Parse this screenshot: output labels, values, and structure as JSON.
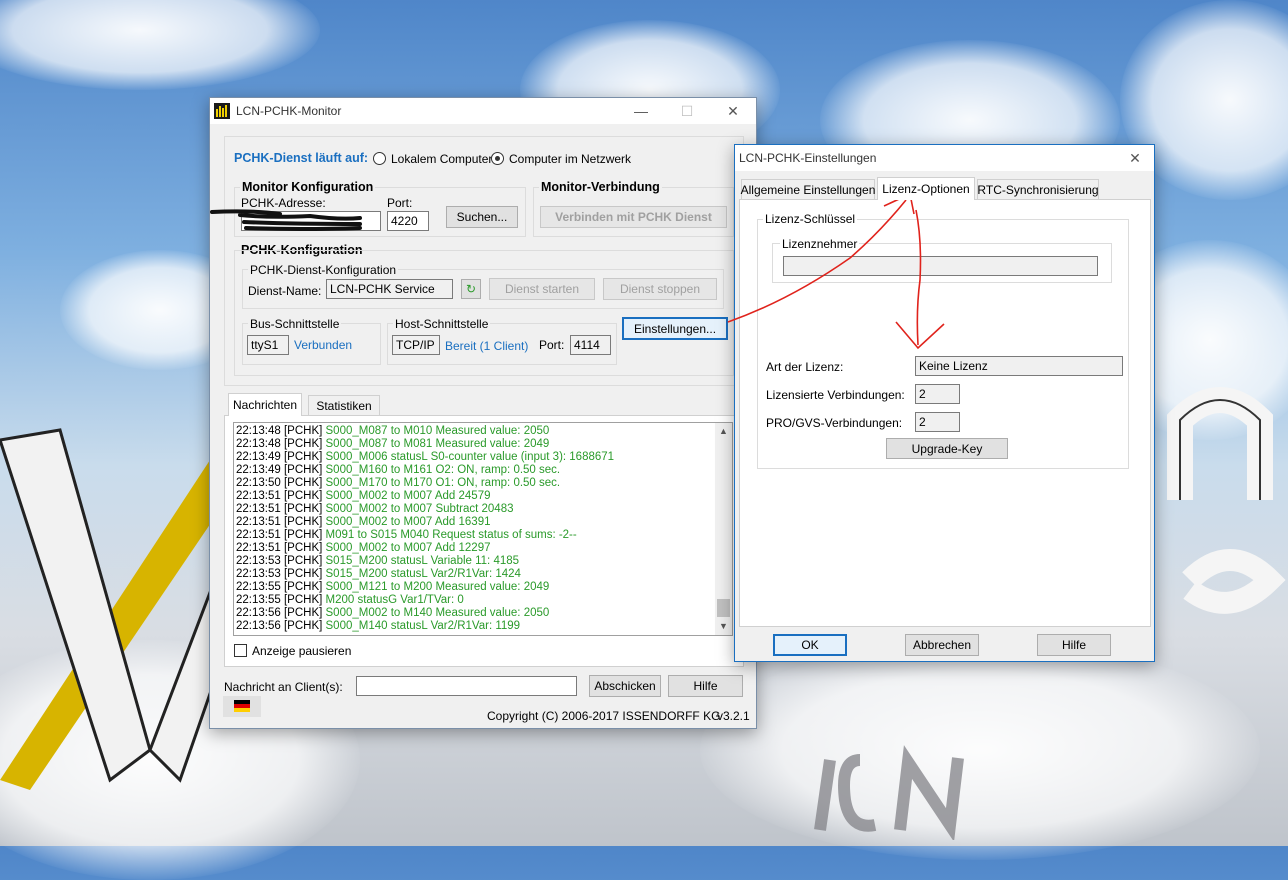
{
  "monitor": {
    "title": "LCN-PCHK-Monitor",
    "service_runs_on_label": "PCHK-Dienst läuft auf:",
    "radio_local": "Lokalem Computer",
    "radio_network": "Computer im Netzwerk",
    "monitor_config_title": "Monitor Konfiguration",
    "pchk_address_label": "PCHK-Adresse:",
    "pchk_address_value": "",
    "port_label": "Port:",
    "port_value": "4220",
    "search_button": "Suchen...",
    "monitor_connection_title": "Monitor-Verbindung",
    "connect_button": "Verbinden mit  PCHK Dienst",
    "pchk_config_title": "PCHK-Konfiguration",
    "service_config_title": "PCHK-Dienst-Konfiguration",
    "service_name_label": "Dienst-Name:",
    "service_name_value": "LCN-PCHK Service",
    "start_service_button": "Dienst starten",
    "stop_service_button": "Dienst stoppen",
    "bus_interface_title": "Bus-Schnittstelle",
    "bus_interface_value": "ttyS1",
    "bus_status": "Verbunden",
    "host_interface_title": "Host-Schnittstelle",
    "host_interface_value": "TCP/IP",
    "host_status": "Bereit (1 Client)",
    "host_port_label": "Port:",
    "host_port_value": "4114",
    "settings_button": "Einstellungen...",
    "tabs": [
      "Nachrichten",
      "Statistiken"
    ],
    "log": [
      {
        "time": "22:13:48",
        "src": "[PCHK]",
        "msg": "S000_M087 to M010 Measured value: 2050"
      },
      {
        "time": "22:13:48",
        "src": "[PCHK]",
        "msg": "S000_M087 to M081 Measured value: 2049"
      },
      {
        "time": "22:13:49",
        "src": "[PCHK]",
        "msg": "S000_M006 statusL S0-counter value (input 3): 1688671"
      },
      {
        "time": "22:13:49",
        "src": "[PCHK]",
        "msg": "S000_M160 to M161 O2: ON, ramp: 0.50 sec."
      },
      {
        "time": "22:13:50",
        "src": "[PCHK]",
        "msg": "S000_M170 to M170 O1: ON, ramp: 0.50 sec."
      },
      {
        "time": "22:13:51",
        "src": "[PCHK]",
        "msg": "S000_M002 to M007 Add 24579"
      },
      {
        "time": "22:13:51",
        "src": "[PCHK]",
        "msg": "S000_M002 to M007 Subtract 20483"
      },
      {
        "time": "22:13:51",
        "src": "[PCHK]",
        "msg": "S000_M002 to M007 Add 16391"
      },
      {
        "time": "22:13:51",
        "src": "[PCHK]",
        "msg": "M091 to S015 M040 Request status of sums: -2--"
      },
      {
        "time": "22:13:51",
        "src": "[PCHK]",
        "msg": "S000_M002 to M007 Add 12297"
      },
      {
        "time": "22:13:53",
        "src": "[PCHK]",
        "msg": "S015_M200 statusL Variable 11: 4185"
      },
      {
        "time": "22:13:53",
        "src": "[PCHK]",
        "msg": "S015_M200 statusL Var2/R1Var: 1424"
      },
      {
        "time": "22:13:55",
        "src": "[PCHK]",
        "msg": "S000_M121 to M200 Measured value: 2049"
      },
      {
        "time": "22:13:55",
        "src": "[PCHK]",
        "msg": "M200 statusG Var1/TVar: 0"
      },
      {
        "time": "22:13:56",
        "src": "[PCHK]",
        "msg": "S000_M002 to M140 Measured value: 2050"
      },
      {
        "time": "22:13:56",
        "src": "[PCHK]",
        "msg": "S000_M140 statusL Var2/R1Var: 1199"
      }
    ],
    "pause_display_label": "Anzeige pausieren",
    "message_to_clients_label": "Nachricht an Client(s):",
    "message_input_value": "",
    "send_button": "Abschicken",
    "help_button": "Hilfe",
    "copyright": "Copyright (C) 2006-2017 ISSENDORFF KG",
    "version": "v3.2.1",
    "language_flag": "german-flag-icon"
  },
  "settings": {
    "title": "LCN-PCHK-Einstellungen",
    "tabs": [
      "Allgemeine Einstellungen",
      "Lizenz-Optionen",
      "RTC-Synchronisierung"
    ],
    "active_tab": 1,
    "license_key_group": "Lizenz-Schlüssel",
    "licensee_group": "Lizenznehmer",
    "licensee_value": "",
    "license_type_label": "Art der Lizenz:",
    "license_type_value": "Keine Lizenz",
    "licensed_connections_label": "Lizensierte Verbindungen:",
    "licensed_connections_value": "2",
    "pro_gvs_label": "PRO/GVS-Verbindungen:",
    "pro_gvs_value": "2",
    "upgrade_button": "Upgrade-Key",
    "ok_button": "OK",
    "cancel_button": "Abbrechen",
    "help_button": "Hilfe"
  },
  "colors": {
    "accent_blue": "#1a6fc0",
    "log_green": "#2a9a2a",
    "annotation_red": "#e0231c"
  }
}
